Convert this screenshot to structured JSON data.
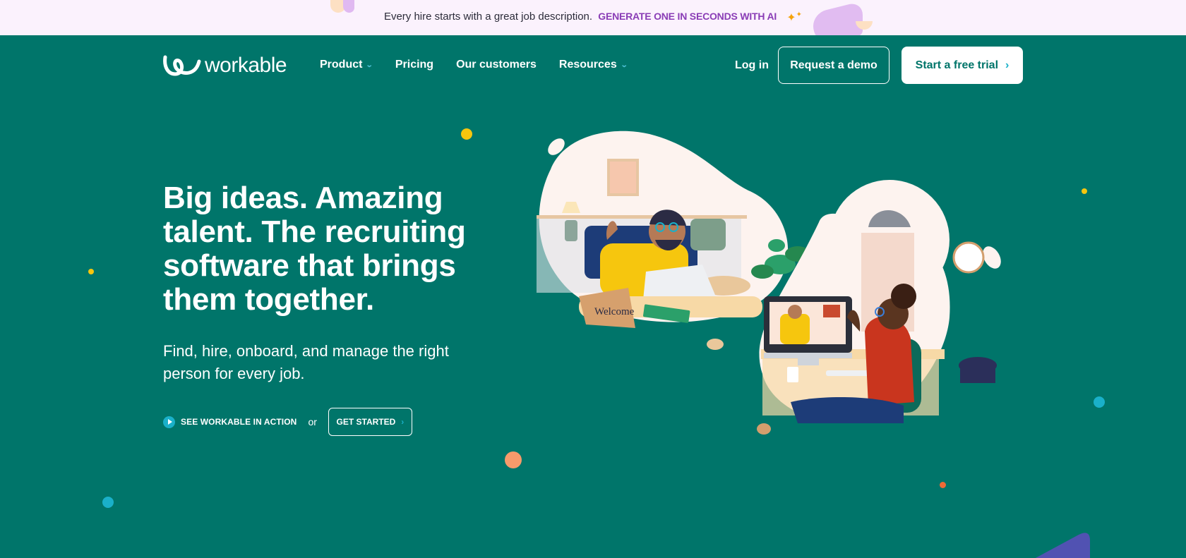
{
  "announcement": {
    "message": "Every hire starts with a great job description.",
    "cta": "GENERATE ONE IN SECONDS WITH AI",
    "sparkle_icon": "sparkle-icon"
  },
  "nav": {
    "logo_text": "workable",
    "links": [
      {
        "label": "Product",
        "has_dropdown": true
      },
      {
        "label": "Pricing",
        "has_dropdown": false
      },
      {
        "label": "Our customers",
        "has_dropdown": false
      },
      {
        "label": "Resources",
        "has_dropdown": true
      }
    ],
    "login": "Log in",
    "request_demo": "Request a demo",
    "free_trial": "Start a free trial"
  },
  "hero": {
    "title": "Big ideas. Amazing talent. The recruiting software that brings them together.",
    "subtitle": "Find, hire, onboard, and manage the right person for every job.",
    "see_action": "SEE WORKABLE IN ACTION",
    "or": "or",
    "get_started": "GET STARTED"
  },
  "illustration": {
    "box_label": "Welcome",
    "alt": "Remote video interview between a man at home and a woman at a desk"
  },
  "colors": {
    "brand_teal": "#00756a",
    "accent_cyan": "#1ab0c9",
    "cta_purple": "#8a3db6",
    "announce_bg": "#fbf2fd"
  }
}
